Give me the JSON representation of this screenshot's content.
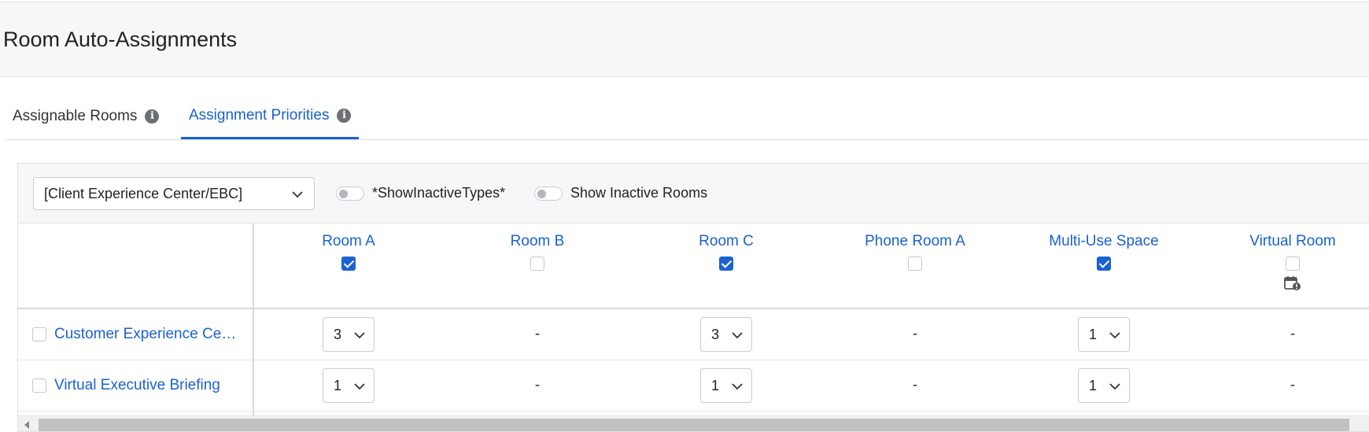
{
  "header": {
    "title": "Room Auto-Assignments"
  },
  "tabs": [
    {
      "label": "Assignable Rooms",
      "active": false
    },
    {
      "label": "Assignment Priorities",
      "active": true
    }
  ],
  "toolbar": {
    "selected_type": "[Client Experience Center/EBC]",
    "toggle_inactive_types_label": "*ShowInactiveTypes*",
    "toggle_inactive_rooms_label": "Show Inactive Rooms"
  },
  "rooms": [
    {
      "name": "Room A",
      "checked": true
    },
    {
      "name": "Room B",
      "checked": false
    },
    {
      "name": "Room C",
      "checked": true
    },
    {
      "name": "Phone Room A",
      "checked": false
    },
    {
      "name": "Multi-Use Space",
      "checked": true
    },
    {
      "name": "Virtual Room",
      "checked": false,
      "icon": "calendar-alert-icon"
    }
  ],
  "rows": [
    {
      "label": "Customer Experience Ce…",
      "cells": [
        "3",
        "-",
        "3",
        "-",
        "1",
        "-"
      ]
    },
    {
      "label": "Virtual Executive Briefing",
      "cells": [
        "1",
        "-",
        "1",
        "-",
        "1",
        "-"
      ]
    }
  ],
  "colors": {
    "accent": "#1a62d0",
    "header_bg": "#f6f7f8"
  }
}
